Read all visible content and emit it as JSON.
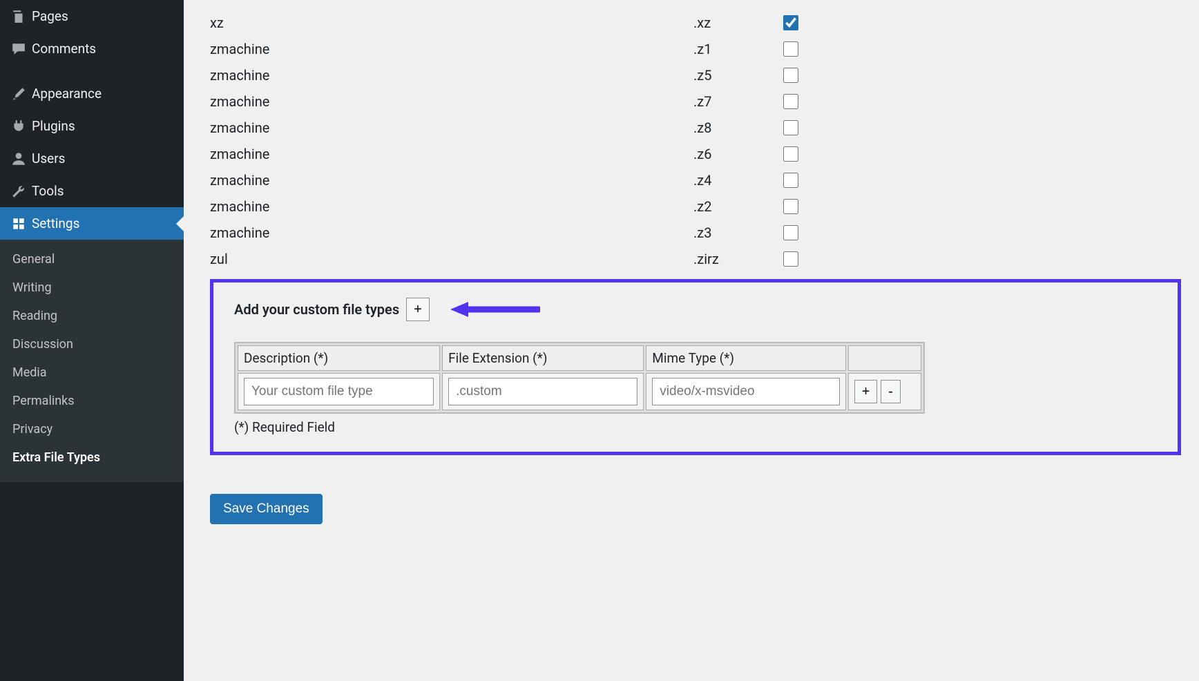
{
  "sidebar": {
    "items": [
      {
        "label": "Pages",
        "icon": "pages-icon"
      },
      {
        "label": "Comments",
        "icon": "comments-icon"
      },
      {
        "label": "Appearance",
        "icon": "appearance-icon"
      },
      {
        "label": "Plugins",
        "icon": "plugins-icon"
      },
      {
        "label": "Users",
        "icon": "users-icon"
      },
      {
        "label": "Tools",
        "icon": "tools-icon"
      },
      {
        "label": "Settings",
        "icon": "settings-icon",
        "active": true
      }
    ],
    "submenu": [
      {
        "label": "General"
      },
      {
        "label": "Writing"
      },
      {
        "label": "Reading"
      },
      {
        "label": "Discussion"
      },
      {
        "label": "Media"
      },
      {
        "label": "Permalinks"
      },
      {
        "label": "Privacy"
      },
      {
        "label": "Extra File Types",
        "current": true
      }
    ]
  },
  "filetypes": [
    {
      "name": "xz",
      "ext": ".xz",
      "checked": true
    },
    {
      "name": "zmachine",
      "ext": ".z1",
      "checked": false
    },
    {
      "name": "zmachine",
      "ext": ".z5",
      "checked": false
    },
    {
      "name": "zmachine",
      "ext": ".z7",
      "checked": false
    },
    {
      "name": "zmachine",
      "ext": ".z8",
      "checked": false
    },
    {
      "name": "zmachine",
      "ext": ".z6",
      "checked": false
    },
    {
      "name": "zmachine",
      "ext": ".z4",
      "checked": false
    },
    {
      "name": "zmachine",
      "ext": ".z2",
      "checked": false
    },
    {
      "name": "zmachine",
      "ext": ".z3",
      "checked": false
    },
    {
      "name": "zul",
      "ext": ".zirz",
      "checked": false
    }
  ],
  "custom": {
    "title": "Add your custom file types",
    "add_btn": "+",
    "headers": {
      "desc": "Description (*)",
      "ext": "File Extension (*)",
      "mime": "Mime Type (*)"
    },
    "row": {
      "desc_placeholder": "Your custom file type",
      "ext_placeholder": ".custom",
      "mime_placeholder": "video/x-msvideo",
      "plus": "+",
      "minus": "-"
    },
    "required_note": "(*) Required Field"
  },
  "save_label": "Save Changes"
}
